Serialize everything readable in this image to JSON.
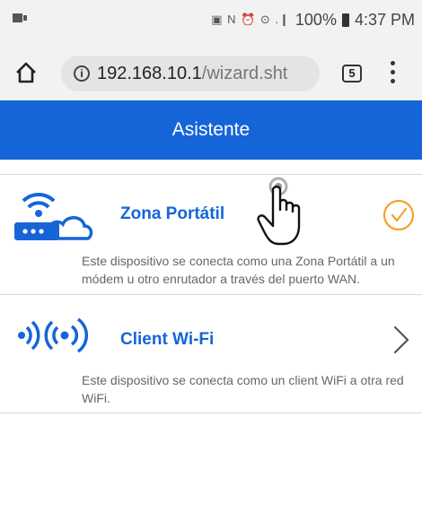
{
  "status_bar": {
    "time": "4:37 PM",
    "battery": "100%",
    "icons": "▣ N ⏰ ⊙ .❙"
  },
  "browser": {
    "url_host": "192.168.10.1",
    "url_path": "/wizard.sht",
    "tab_count": "5"
  },
  "header": {
    "title": "Asistente"
  },
  "options": [
    {
      "label": "Zona Portátil",
      "description": "Este dispositivo se conecta como una Zona Portátil a un módem u otro enrutador a través del puerto WAN."
    },
    {
      "label": "Client Wi-Fi",
      "description": "Este dispositivo se conecta como un client WiFi a otra red WiFi."
    }
  ],
  "colors": {
    "accent": "#1565d8",
    "check": "#f4a12a"
  }
}
